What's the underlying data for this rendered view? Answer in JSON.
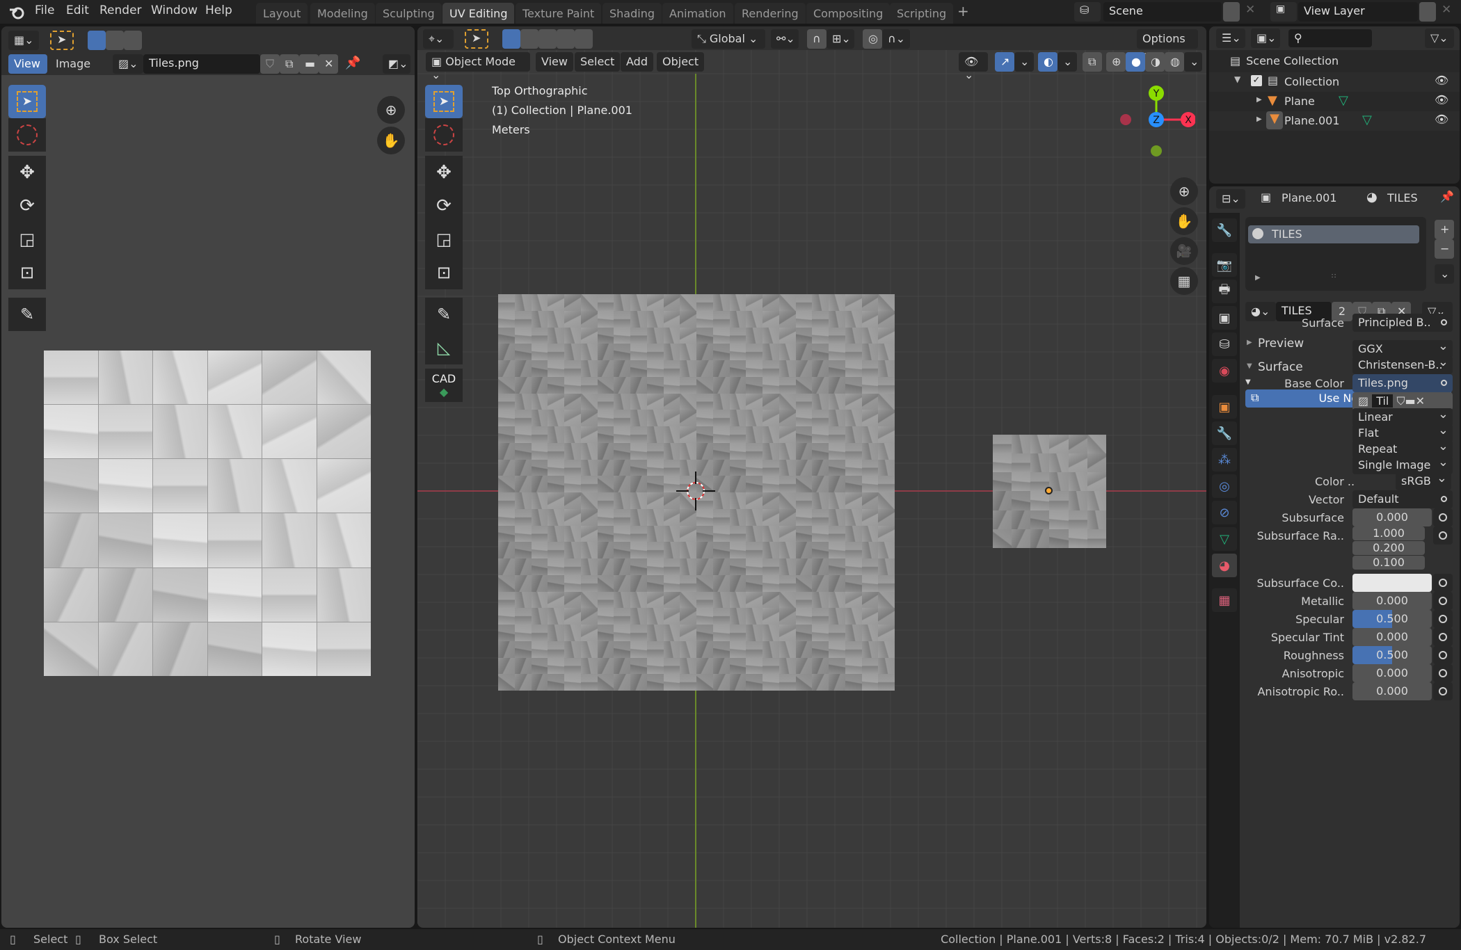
{
  "topbar": {
    "menus": [
      "File",
      "Edit",
      "Render",
      "Window",
      "Help"
    ],
    "workspaces": [
      "Layout",
      "Modeling",
      "Sculpting",
      "UV Editing",
      "Texture Paint",
      "Shading",
      "Animation",
      "Rendering",
      "Compositing",
      "Scripting"
    ],
    "active_workspace": "UV Editing",
    "add_workspace": "+",
    "scene": "Scene",
    "view_layer": "View Layer"
  },
  "image_editor": {
    "menus": [
      "View",
      "Image"
    ],
    "active_menu": "View",
    "image_name": "Tiles.png",
    "tiles_grid": 6
  },
  "viewport": {
    "mode": "Object Mode",
    "menus": [
      "View",
      "Select",
      "Add",
      "Object"
    ],
    "transform_orientation": "Global",
    "options_label": "Options",
    "overlay_text": [
      "Top Orthographic",
      "(1) Collection | Plane.001",
      "Meters"
    ],
    "gizmo": {
      "x": "X",
      "y": "Y",
      "z": "Z"
    },
    "tools": [
      "select-box",
      "cursor",
      "move",
      "rotate",
      "scale",
      "transform",
      "annotate",
      "measure",
      "cad"
    ],
    "cad_label": "CAD"
  },
  "outliner": {
    "root": "Scene Collection",
    "items": [
      {
        "name": "Collection",
        "type": "collection"
      },
      {
        "name": "Plane",
        "type": "mesh"
      },
      {
        "name": "Plane.001",
        "type": "mesh"
      }
    ]
  },
  "properties": {
    "object": "Plane.001",
    "material": "TILES",
    "slot": "TILES",
    "material_users": "2",
    "sections": {
      "preview": "Preview",
      "surface": "Surface"
    },
    "use_nodes": "Use Nodes",
    "rows": [
      {
        "label": "Surface",
        "value": "Principled B..",
        "kind": "link"
      },
      {
        "label": "",
        "value": "GGX",
        "kind": "enum"
      },
      {
        "label": "",
        "value": "Christensen-B..",
        "kind": "enum"
      },
      {
        "label": "Base Color",
        "value": "Tiles.png",
        "kind": "link"
      },
      {
        "label": "",
        "value": "Til",
        "kind": "image"
      },
      {
        "label": "",
        "value": "Linear",
        "kind": "enum"
      },
      {
        "label": "",
        "value": "Flat",
        "kind": "enum"
      },
      {
        "label": "",
        "value": "Repeat",
        "kind": "enum"
      },
      {
        "label": "",
        "value": "Single Image",
        "kind": "enum"
      },
      {
        "label": "Color ..",
        "value": "sRGB",
        "kind": "colorspace"
      },
      {
        "label": "Vector",
        "value": "Default",
        "kind": "link"
      },
      {
        "label": "Subsurface",
        "value": "0.000",
        "kind": "num"
      },
      {
        "label": "Subsurface Ra..",
        "value": [
          "1.000",
          "0.200",
          "0.100"
        ],
        "kind": "vec"
      },
      {
        "label": "Subsurface Co..",
        "value": "#e8e8e8",
        "kind": "color"
      },
      {
        "label": "Metallic",
        "value": "0.000",
        "kind": "num"
      },
      {
        "label": "Specular",
        "value": "0.500",
        "kind": "slider",
        "fraction": 0.5
      },
      {
        "label": "Specular Tint",
        "value": "0.000",
        "kind": "num"
      },
      {
        "label": "Roughness",
        "value": "0.500",
        "kind": "slider",
        "fraction": 0.5
      },
      {
        "label": "Anisotropic",
        "value": "0.000",
        "kind": "num"
      },
      {
        "label": "Anisotropic Ro..",
        "value": "0.000",
        "kind": "num"
      }
    ]
  },
  "statusbar": {
    "select": "Select",
    "box_select": "Box Select",
    "rotate_view": "Rotate View",
    "context_menu": "Object Context Menu",
    "info": "Collection | Plane.001 | Verts:8 | Faces:2 | Tris:4 | Objects:0/2 | Mem: 70.7 MiB | v2.82.7"
  },
  "colors": {
    "accent": "#4772b3",
    "x_axis": "#ff3352",
    "y_axis": "#8bdc00",
    "z_axis": "#2890ff",
    "origin": "#ffaa33"
  }
}
